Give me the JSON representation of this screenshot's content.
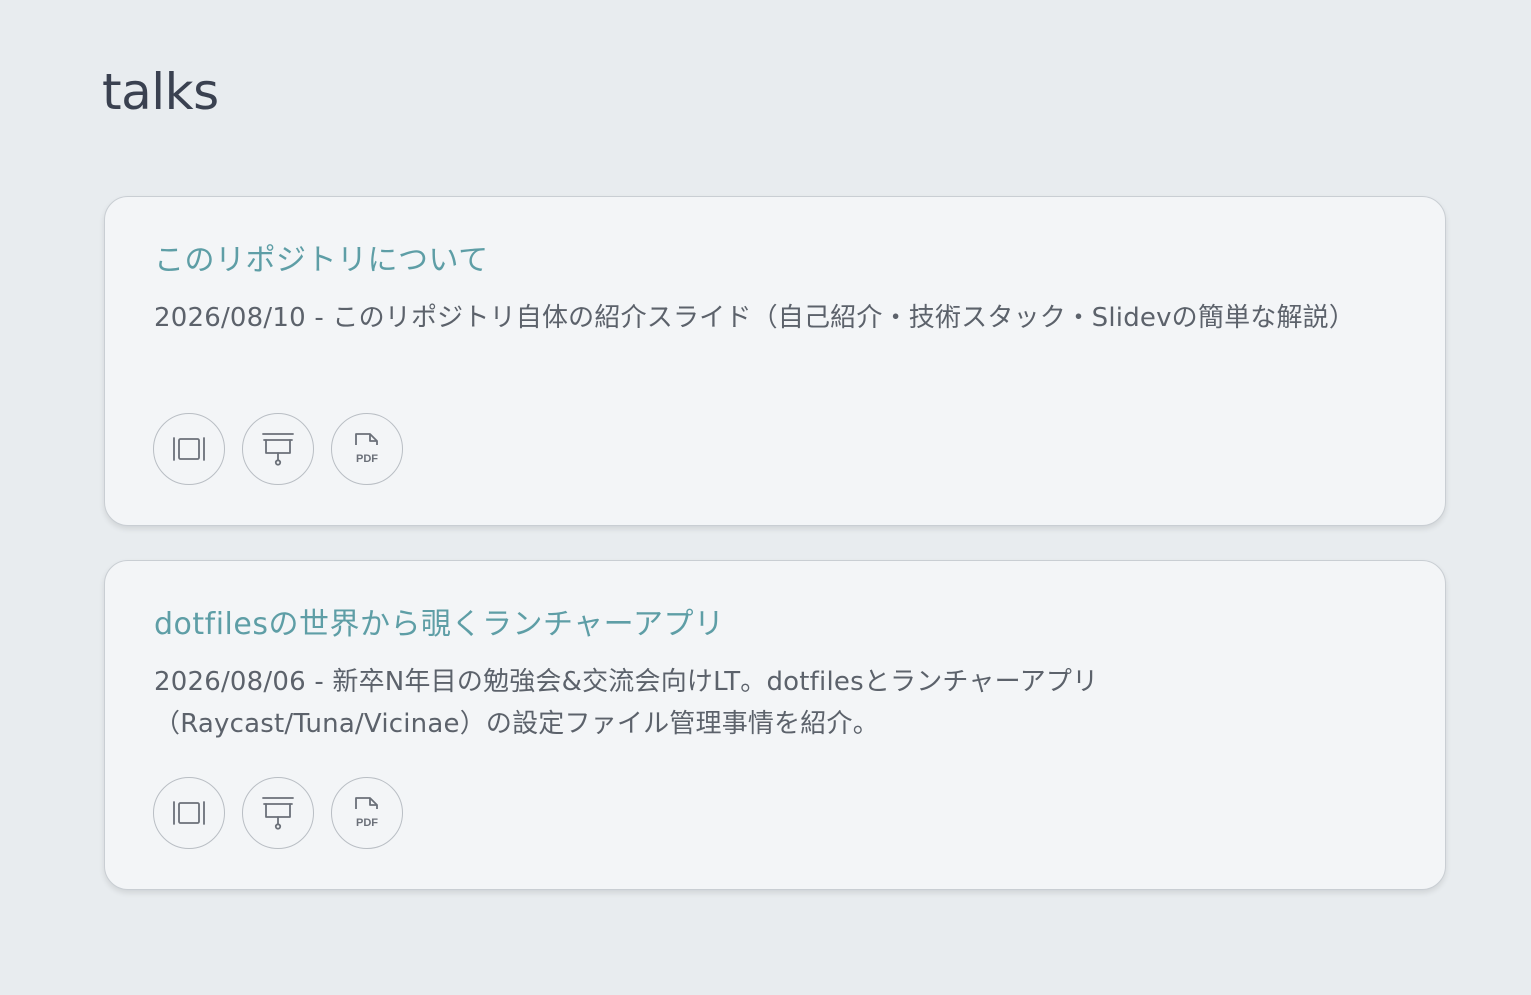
{
  "page": {
    "title": "talks"
  },
  "talks": [
    {
      "title": "このリポジトリについて",
      "description": "2026/08/10 - このリポジトリ自体の紹介スライド（自己紹介・技術スタック・Slidevの簡単な解説）",
      "actions": [
        {
          "icon": "slides-icon"
        },
        {
          "icon": "presentation-icon"
        },
        {
          "icon": "pdf-icon",
          "label": "PDF"
        }
      ]
    },
    {
      "title": "dotfilesの世界から覗くランチャーアプリ",
      "description": "2026/08/06 - 新卒N年目の勉強会&交流会向けLT。dotfilesとランチャーアプリ（Raycast/Tuna/Vicinae）の設定ファイル管理事情を紹介。",
      "actions": [
        {
          "icon": "slides-icon"
        },
        {
          "icon": "presentation-icon"
        },
        {
          "icon": "pdf-icon",
          "label": "PDF"
        }
      ]
    }
  ],
  "colors": {
    "background": "#e8ecef",
    "card": "#f3f5f7",
    "title_accent": "#5e9ea6",
    "text": "#5c626b",
    "icon": "#6b7079"
  }
}
